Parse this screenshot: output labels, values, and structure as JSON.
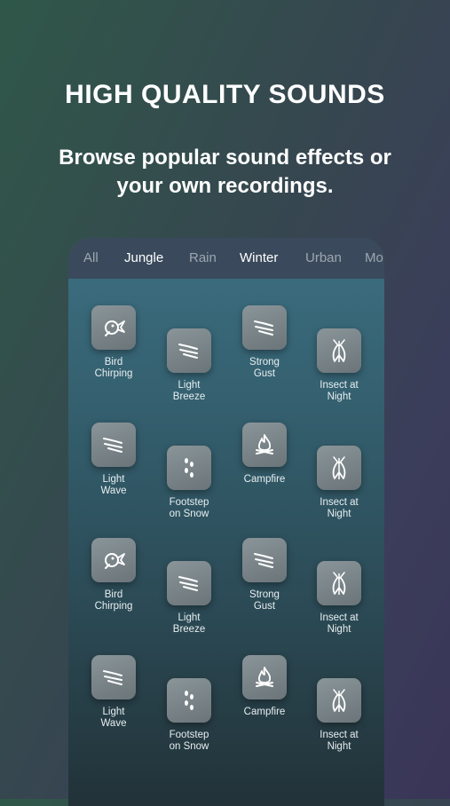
{
  "header": {
    "title": "HIGH QUALITY SOUNDS",
    "subtitle": "Browse popular sound effects or\nyour own recordings."
  },
  "tabs": [
    {
      "label": "All",
      "active": false
    },
    {
      "label": "Jungle",
      "active": true
    },
    {
      "label": "Rain",
      "active": false
    },
    {
      "label": "Winter",
      "active": true
    },
    {
      "label": "Urban",
      "active": false
    },
    {
      "label": "Mo",
      "active": false
    }
  ],
  "sounds": [
    {
      "label": "Bird\nChirping",
      "icon": "bird-icon"
    },
    {
      "label": "Light\nBreeze",
      "icon": "wind-icon"
    },
    {
      "label": "Strong\nGust",
      "icon": "wind-icon"
    },
    {
      "label": "Insect at\nNight",
      "icon": "insect-icon"
    },
    {
      "label": "Light\nWave",
      "icon": "wind-icon"
    },
    {
      "label": "Footstep\non Snow",
      "icon": "footsteps-icon"
    },
    {
      "label": "Campfire",
      "icon": "fire-icon"
    },
    {
      "label": "Insect at\nNight",
      "icon": "insect-icon"
    },
    {
      "label": "Bird\nChirping",
      "icon": "bird-icon"
    },
    {
      "label": "Light\nBreeze",
      "icon": "wind-icon"
    },
    {
      "label": "Strong\nGust",
      "icon": "wind-icon"
    },
    {
      "label": "Insect at\nNight",
      "icon": "insect-icon"
    },
    {
      "label": "Light\nWave",
      "icon": "wind-icon"
    },
    {
      "label": "Footstep\non Snow",
      "icon": "footsteps-icon"
    },
    {
      "label": "Campfire",
      "icon": "fire-icon"
    },
    {
      "label": "Insect at\nNight",
      "icon": "insect-icon"
    }
  ]
}
